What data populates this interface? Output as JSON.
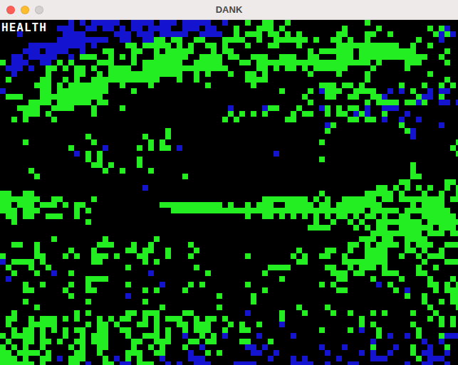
{
  "window": {
    "title": "DANK",
    "controls": [
      {
        "name": "close",
        "color": "#ff5f57",
        "disabled": false
      },
      {
        "name": "minimize",
        "color": "#febc2e",
        "disabled": false
      },
      {
        "name": "zoom",
        "color": "#d4d0d0",
        "disabled": true
      }
    ]
  },
  "hud": {
    "label": "HEALTH"
  },
  "grid": {
    "cell_kinds": [
      {
        "char": "g",
        "color": "#22ee22"
      },
      {
        "char": "b",
        "color": "#1414d0"
      },
      {
        "char": "r",
        "color": "#e01010"
      }
    ],
    "rows": [
      "............b.b.bbbbb..bbbb.bbb.bbbbb..b...g..gg..g.............g...............",
      "..........bbb..bb.bb.b.bb.bbbb..bbb.bb...g...ggg.g..........g.....g........g.gb.",
      "...b.......bbbb.....bbb.bbb.bbbbb..bbbb..g.ggg.gg.g.g......gg...gg..g.......gbgb",
      "..........bbbbbbbbb..bb..bbgg.gg..gg...gggg..g..gggggg.g..gg.g..g........g...b..",
      ".....bbbbbbbbbb.b.....gg.ggggg.g.g..gg.g...g...gg...g......ggggggggggg..g..g...",
      "....bbb.bbbb..b...gg...gg..g.ggggg...g.gg.............g.gggggg.gggggggggg.....g",
      "..bb.bbbbb..b.ggg..g.g.g...gggggg..gggg.gg..ggg..ggg..gg...ggg.gggggggggggg..g..",
      "g.bbb..bb.g.g....ggg...g.ggggggg..ggggg...gg.gggggggggggggggggggg.g....ggg....g..",
      ".bbb.b..gg.g.gg.g..gggg..ggggggggggggggg.....gg.g.gg.g.gggggg....g.....g.........",
      "..b.....g....gg..g.ggggggggggggg..g.g...g..gg.g.......g....g....g..........g.....",
      ".g.....gg..g.g..gggggggggggg...g..g........gggg.................g.............g",
      "......ggg.g.ggggggg..g....g.........g.......g...........ggg.gg.g......g...g..g.g..",
      "b......gg.ggggggggg....g.........................g....g.bggg..gggg..b.b.g..b.bb...",
      ".ggg...ggggggggggg...................................g...gg..gg..ggb.....gbb.g....bbbb.",
      ".....gggg.gggggg.gg...................................g.........g.gggg.ggbg..bb.b",
      "...gggg..gggg...g....g..................b.....bgg...g...bg.g.gg.b..bbb.",
      "....ggg.g.......g.......................g.g.g.g....g.gg..g.gg.bgb..g...b",
      "..g.g....g.............................g.g........gg.........gg.gg.b..b..b",
      ".........................................................bg...........g......b",
      ".............................g...........................g.............gb.....",
      "...............g.........g...g..........................................b.....",
      "....g...........g.........g.g...........................g.......................g",
      "............g.....b.....g.g.gg.b...............................................g....",
      ".............b.g.g..............................b...............................g.....",
      "...............g.g......g...............................g......................",
      "................gg.g....g...............................................g.........g..",
      ".....g............g..g....g.............................................g.........",
      "......g.........................g.......................................gg..........g....",
      "......................................................................gg......gg...g....",
      ".........................b........................................gg.g.g.g.g..g.ggg.ggg",
      "gg..gg..................................................g.......ggggg.g...g..g..g...",
      "ggggggg..gg.....g.............................gggggggg.g.g..gggggg.gg.gggggggg.ggggggggg",
      "gg.ggg.ggg.g.gg.............ggggggggggg.g..g.ggg..ggggg.gg.gggggggg.....g.gggg..",
      "ggg.ggg......g.g..............gggggggggggggggggggggggggggggggggg.ggggg.gggggggg",
      ".gg.gg..ggg..g.............................g..gg.g.g.g.g.g.gg.g.gg.g..gg..gggggg.ggg.gg",
      "..g............g.......................................g..g..g.g..gggggggg.gggggg..",
      "......................................................gggg....g.g.gg..gggggg.ggg",
      ".................................................................ggggggggg.ggg.ggg",
      ".........g........g........g...................................ggg.gg..gggg",
      "..gg..g..........ggg...g..g......g...........................gg.g.gggg.g.ggg..ggg.",
      "......g.....g...g.....gg.gg..g....g.................g....gg..g..gggg...gg.g..g.",
      "g.....gg...g.g..ggg.g...gg...g...g.........g.......g.g..gg..g...gggg..g..g.ggg..",
      "b.gggg.g........gg.......g.g........................gg......gggggggg......g...ggg.",
      ".g...g..g.............g...........g............gggg......gg..g.ggg.g.....g..g...",
      "..g...g..b..g.............b.........g.........g...........ggg.gg...ggg...gg.....",
      ".b.............gggg..............................g.........gg....g....g....g...g....",
      "....g..g....g..g......g.....b....g.g.......g............g.g.......b.g......gg.g.gg.",
      "....gg.....g...gg........g.g....g.............g............gg........g.b....g.ggg.....",
      "............g.........b...............g.....g..........................g..g....ggg....g.",
      "....g..........g.........g..................g.............................g..g.gg.g...gg...",
      "......g.....................g.........g.............g....g.................g....g..gg.g..",
      "..g..........g.g......gg.ggg....gg.........b.....g...g....g..g...g.g....g...g.....",
      ".gg..g.ggg g.g...g.g.gg..g.g.ggg..g.gg.g.........g.............g...........g.g.g.",
      ".g...ggggg.....g.gg.g...gg.g...gg.ggg...g.g..g...b.............g.g......g....g.g",
      "..g.gg.g.g.g.gg..gg..gg....g.g..g.ggg..g..gg............g....g.b..g......g......",
      "g.gggg.g...g..g.ggg...g..ggg.g..b..g.g.b.....b.....b..............g.b..b.g...gbbbg",
      ".g..gg.gg.g..gg.ggg....gg..ggg...gg.gg....gg...g.................b........b..b.....",
      "g.g.g..g....g.g..gg....g..g.g...g..b.......bb.b.........b...b....g...b..g..b..g.",
      "gg.gggg.g....gg..g....ggg..gg....b..g.g.....bb..b........b.....b.b..b...g.bb..b..",
      "ggg.g..gg.b.ggg...g.b.g.g...b....bbb...........b...b.b.....b.....bbb.....g.bbb...r",
      "gggggg.g....gg.b..gg.bb.ggg..b.b..bbb....bbbb......bbbb..b...bb........b..bb..b."
    ]
  }
}
